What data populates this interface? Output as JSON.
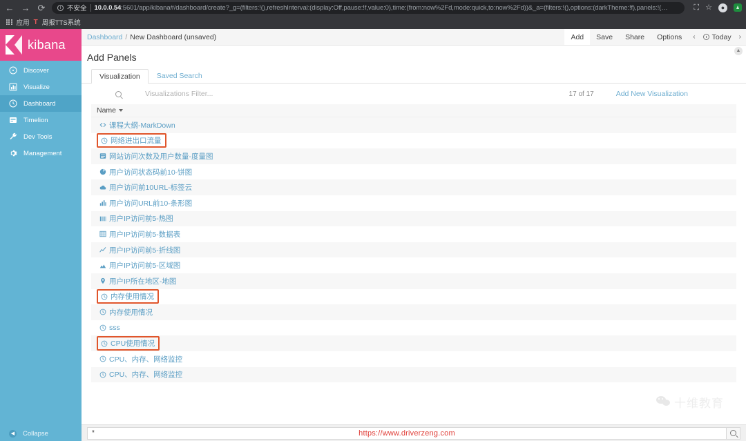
{
  "browser": {
    "back_icon": "←",
    "forward_icon": "→",
    "reload_icon": "⟳",
    "security_label": "不安全",
    "url_host": "10.0.0.54",
    "url_rest": ":5601/app/kibana#/dashboard/create?_g=(filters:!(),refreshInterval:(display:Off,pause:!f,value:0),time:(from:now%2Fd,mode:quick,to:now%2Fd))&_a=(filters:!(),options:(darkTheme:!f),panels:!(…",
    "bookmarks": [
      {
        "label": "应用",
        "icon": "apps-grid-icon"
      },
      {
        "label": "周报TTS系统",
        "icon": "bookmark-favicon"
      }
    ],
    "toolbar_icons": [
      "cast-icon",
      "bookmark-star-icon",
      "profile-avatar-icon",
      "extension-icon"
    ]
  },
  "sidebar": {
    "brand": "kibana",
    "items": [
      {
        "label": "Discover",
        "icon": "compass-icon",
        "active": false
      },
      {
        "label": "Visualize",
        "icon": "bar-chart-icon",
        "active": false
      },
      {
        "label": "Dashboard",
        "icon": "clock-dashboard-icon",
        "active": true
      },
      {
        "label": "Timelion",
        "icon": "timelion-icon",
        "active": false
      },
      {
        "label": "Dev Tools",
        "icon": "wrench-icon",
        "active": false
      },
      {
        "label": "Management",
        "icon": "gear-icon",
        "active": false
      }
    ],
    "collapse_label": "Collapse"
  },
  "topbar": {
    "breadcrumb_root": "Dashboard",
    "breadcrumb_sep": "/",
    "breadcrumb_current": "New Dashboard (unsaved)",
    "menu": [
      {
        "label": "Add",
        "selected": true
      },
      {
        "label": "Save",
        "selected": false
      },
      {
        "label": "Share",
        "selected": false
      },
      {
        "label": "Options",
        "selected": false
      }
    ],
    "prev_arrow": "‹",
    "next_arrow": "›",
    "time_label": "Today",
    "collapse_chevron": "▲"
  },
  "page": {
    "title": "Add Panels"
  },
  "tabs": [
    {
      "label": "Visualization",
      "active": true
    },
    {
      "label": "Saved Search",
      "active": false
    }
  ],
  "search": {
    "placeholder": "Visualizations Filter...",
    "value": "",
    "icon": "search-icon",
    "count_label": "17 of 17",
    "add_new_label": "Add New Visualization"
  },
  "list": {
    "column_header": "Name",
    "sort_icon": "caret-down-icon",
    "rows": [
      {
        "label": "课程大纲-MarkDown",
        "icon": "markdown-code-icon",
        "highlighted": false
      },
      {
        "label": "网络进出口流量",
        "icon": "clock-vis-icon",
        "highlighted": true
      },
      {
        "label": "网站访问次数及用户数量-度量图",
        "icon": "metric-icon",
        "highlighted": false
      },
      {
        "label": "用户访问状态码前10-饼图",
        "icon": "pie-chart-icon",
        "highlighted": false
      },
      {
        "label": "用户访问前10URL-标签云",
        "icon": "tag-cloud-icon",
        "highlighted": false
      },
      {
        "label": "用户访问URL前10-条形图",
        "icon": "bar-chart-icon",
        "highlighted": false
      },
      {
        "label": "用户IP访问前5-热图",
        "icon": "heatmap-icon",
        "highlighted": false
      },
      {
        "label": "用户IP访问前5-数据表",
        "icon": "table-icon",
        "highlighted": false
      },
      {
        "label": "用户IP访问前5-折线图",
        "icon": "line-chart-icon",
        "highlighted": false
      },
      {
        "label": "用户IP访问前5-区域图",
        "icon": "area-chart-icon",
        "highlighted": false
      },
      {
        "label": "用户IP所在地区-地图",
        "icon": "map-pin-icon",
        "highlighted": false
      },
      {
        "label": "内存使用情况",
        "icon": "clock-vis-icon",
        "highlighted": true
      },
      {
        "label": "内存使用情况",
        "icon": "clock-vis-icon",
        "highlighted": false
      },
      {
        "label": "sss",
        "icon": "clock-vis-icon",
        "highlighted": false
      },
      {
        "label": "CPU使用情况",
        "icon": "clock-vis-icon",
        "highlighted": true
      },
      {
        "label": "CPU、内存、网络监控",
        "icon": "clock-vis-icon",
        "highlighted": false
      },
      {
        "label": "CPU、内存、网络监控",
        "icon": "clock-vis-icon",
        "highlighted": false
      }
    ]
  },
  "watermark": {
    "brand_text": "十维教育",
    "icon": "wechat-icon"
  },
  "query_bar": {
    "value": "*",
    "search_icon": "search-icon",
    "url_watermark": "https://www.driverzeng.com"
  },
  "colors": {
    "brand_pink": "#e8488b",
    "sidebar_blue": "#62b4d4",
    "sidebar_active": "#4fa4c7",
    "link_blue": "#6faed0",
    "highlight_orange": "#e0552b",
    "watermark_red": "#e0403a"
  }
}
